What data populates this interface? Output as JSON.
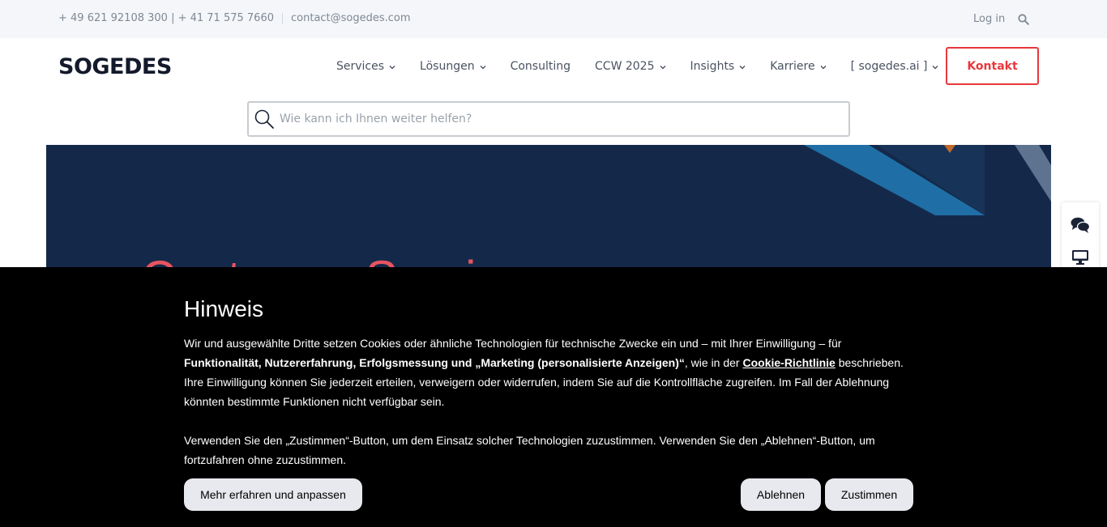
{
  "topbar": {
    "phones": "+ 49 621 92108 300 | + 41 71 575 7660",
    "email": "contact@sogedes.com",
    "login": "Log in"
  },
  "header": {
    "logo": "SOGEDES",
    "nav": [
      {
        "label": "Services",
        "dropdown": true
      },
      {
        "label": "Lösungen",
        "dropdown": true
      },
      {
        "label": "Consulting",
        "dropdown": false
      },
      {
        "label": "CCW 2025",
        "dropdown": true
      },
      {
        "label": "Insights",
        "dropdown": true
      },
      {
        "label": "Karriere",
        "dropdown": true
      },
      {
        "label": "[ sogedes.ai ]",
        "dropdown": true
      }
    ],
    "cta": "Kontakt"
  },
  "search": {
    "placeholder": "Wie kann ich Ihnen weiter helfen?",
    "value": ""
  },
  "hero": {
    "title": "Customer Service"
  },
  "cookie": {
    "title": "Hinweis",
    "p1_a": "Wir und ausgewählte Dritte setzen Cookies oder ähnliche Technologien für technische Zwecke ein und – mit Ihrer Einwilligung – für ",
    "p1_bold": "Funktionalität, Nutzererfahrung, Erfolgsmessung und „Marketing (personalisierte Anzeigen)“",
    "p1_b": ", wie in der ",
    "p1_link": "Cookie-Richtlinie",
    "p1_c": " beschrieben. Ihre Einwilligung können Sie jederzeit erteilen, verweigern oder widerrufen, indem Sie auf die Kontrollfläche zugreifen. Im Fall der Ablehnung könnten bestimmte Funktionen nicht verfügbar sein.",
    "p2": "Verwenden Sie den „Zustimmen“-Button, um dem Einsatz solcher Technologien zuzustimmen. Verwenden Sie den „Ablehnen“-Button, um fortzufahren ohne zuzustimmen.",
    "btn_more": "Mehr erfahren und anpassen",
    "btn_reject": "Ablehnen",
    "btn_accept": "Zustimmen"
  },
  "colors": {
    "accent": "#e8383d",
    "hero_bg": "#14294a",
    "hero_title": "#e9545f",
    "cookie_bg": "#000000"
  },
  "icons": {
    "topbar_search": "search-icon",
    "searchbox": "magnifier-icon",
    "side_chat": "chat-icon",
    "side_monitor": "monitor-icon",
    "nav_chevron": "chevron-down-icon"
  }
}
